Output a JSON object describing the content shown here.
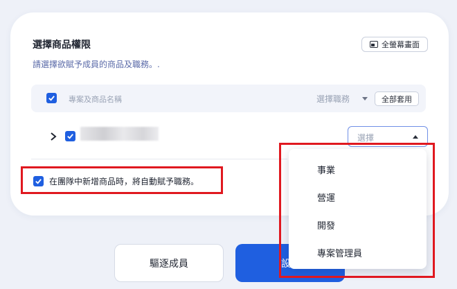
{
  "panel": {
    "title": "選擇商品權限",
    "subtitle": "請選擇欲賦予成員的商品及職務。.",
    "fullscreen_label": "全螢幕畫面"
  },
  "table": {
    "header_name": "專案及商品名稱",
    "header_role": "選擇職務",
    "apply_all_label": "全部套用",
    "row": {
      "role_placeholder": "選擇"
    }
  },
  "auto_assign_label": "在團隊中新增商品時，將自動賦予職務。",
  "role_options": [
    "事業",
    "營運",
    "開發",
    "專案管理員"
  ],
  "footer": {
    "kick_label": "驅逐成員",
    "confirm_label": "設"
  },
  "colors": {
    "accent": "#1f5fe0",
    "highlight": "#e0181f",
    "background": "#eef1f8"
  }
}
